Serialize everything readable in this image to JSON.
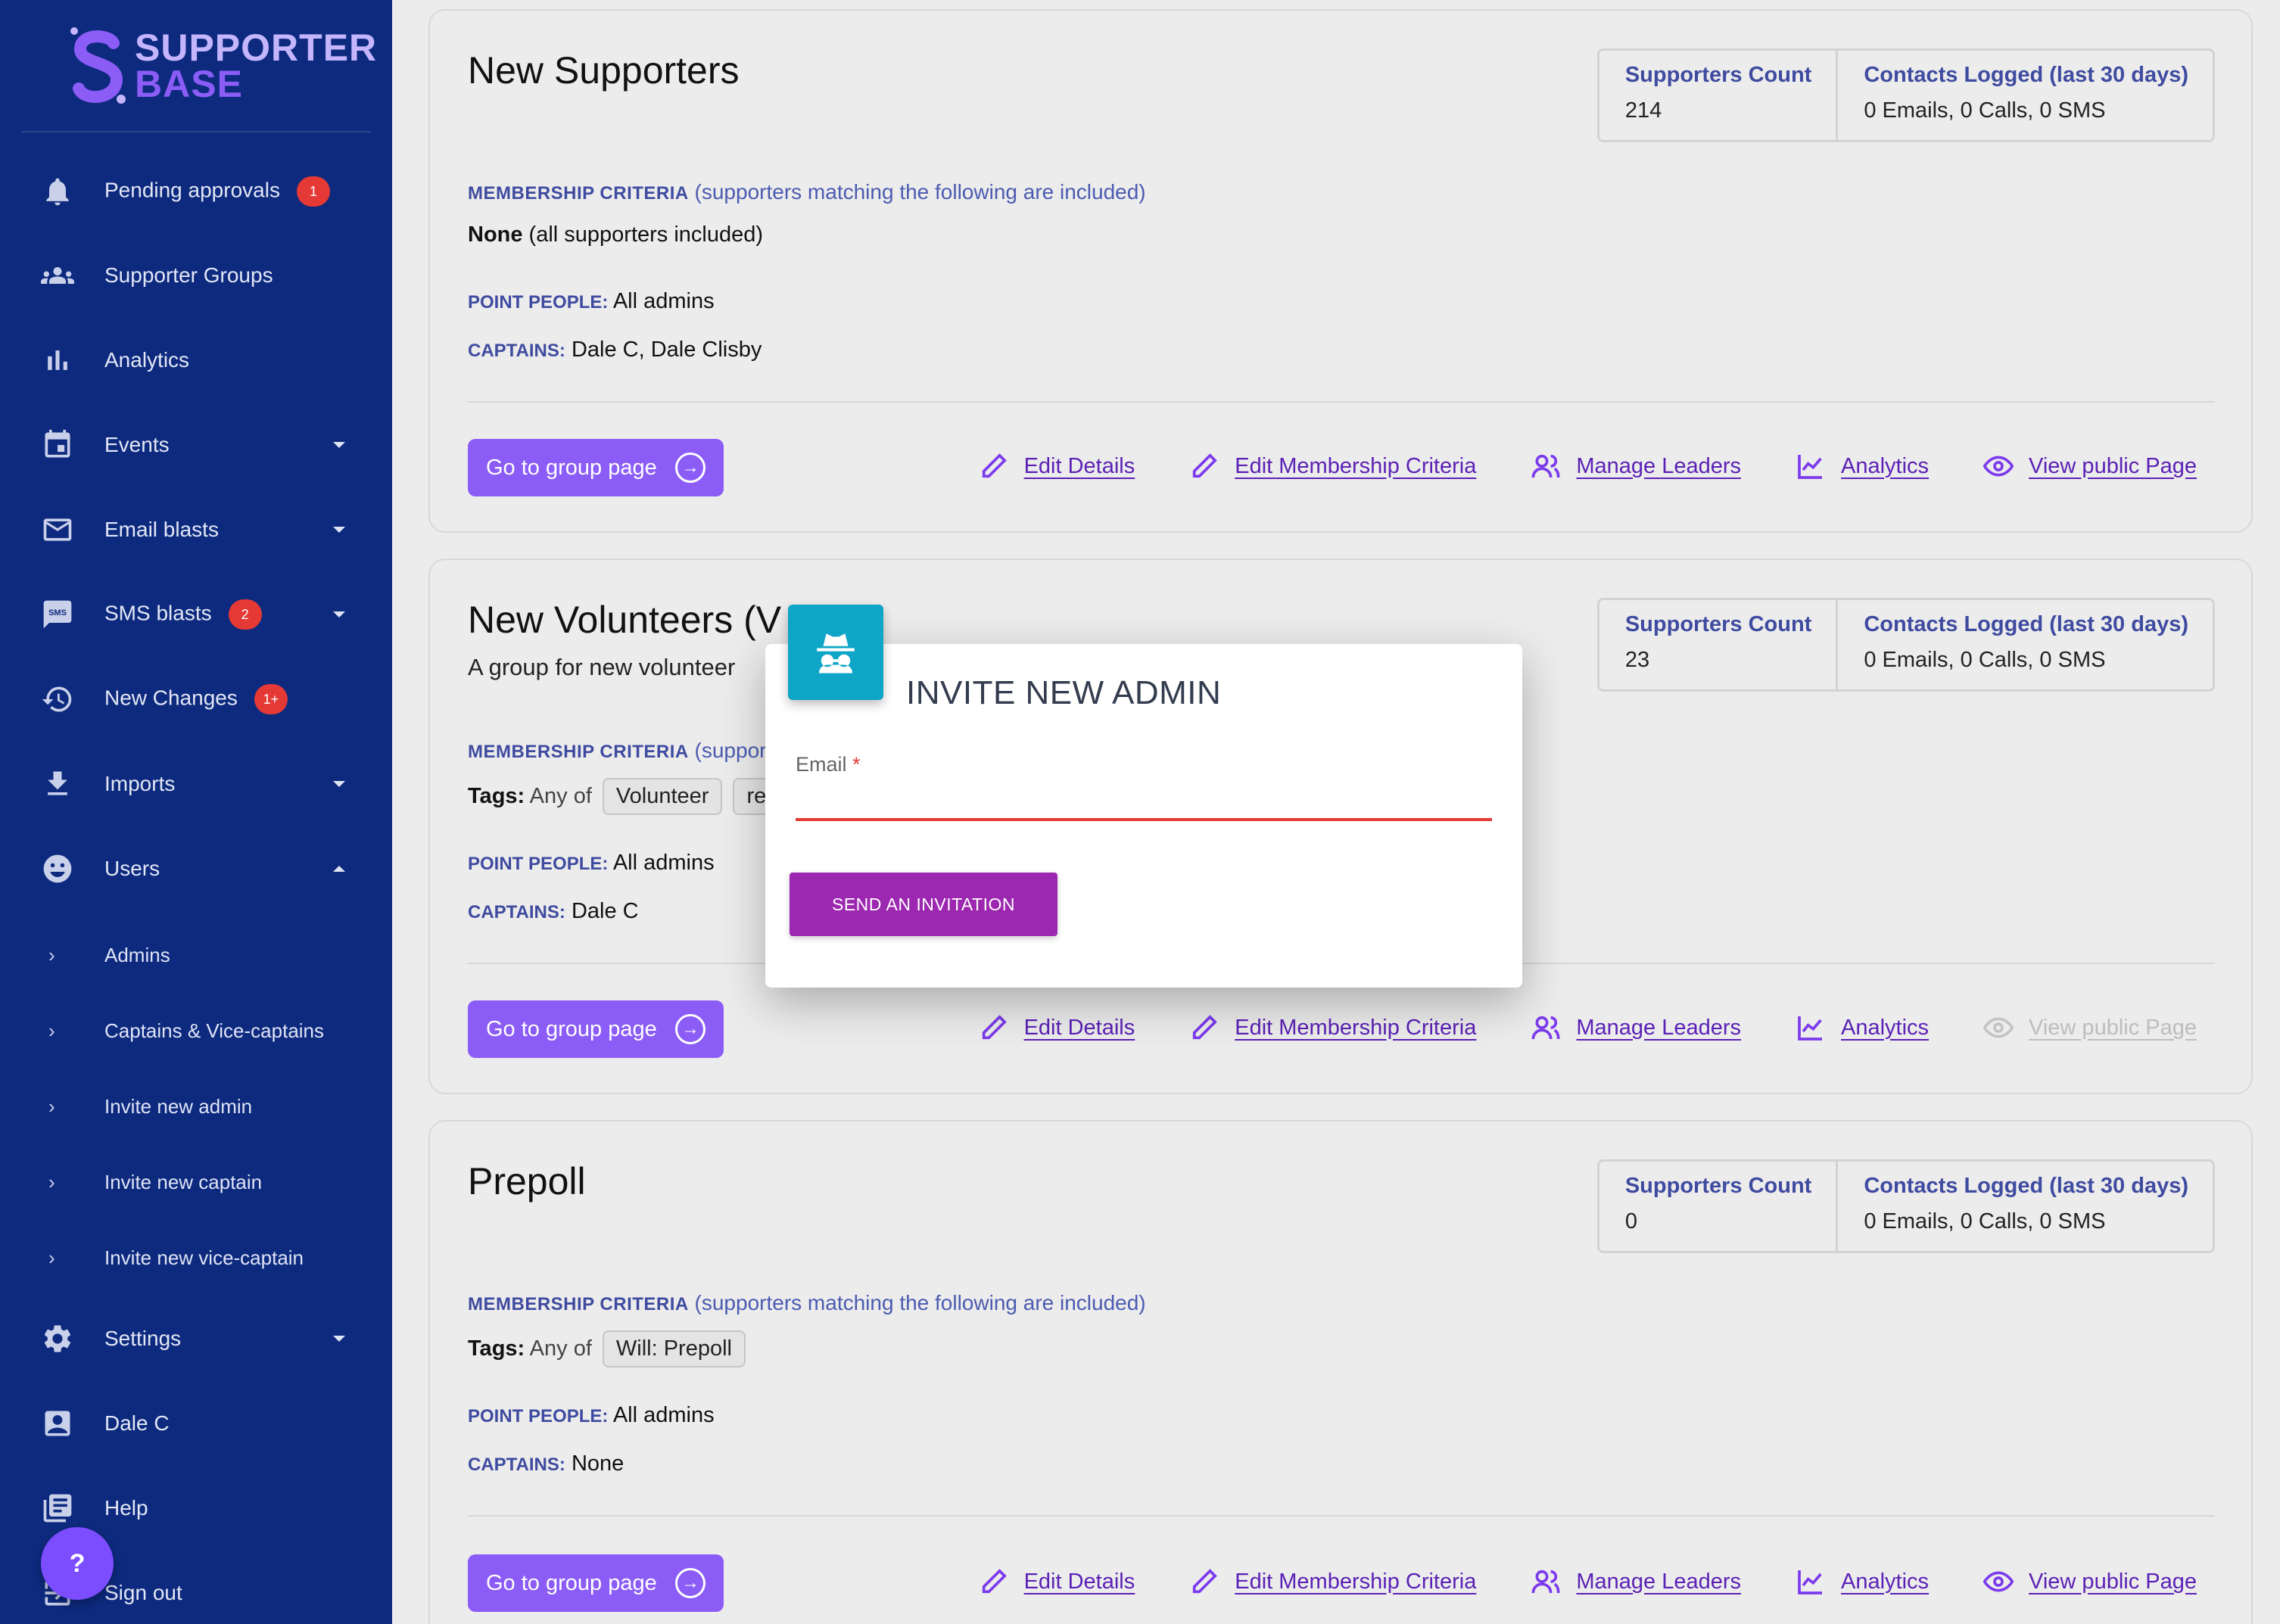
{
  "brand": {
    "line1": "SUPPORTER",
    "line2": "BASE"
  },
  "sidebar": {
    "items": [
      {
        "label": "Pending approvals",
        "badge": "1",
        "icon": "bell-icon"
      },
      {
        "label": "Supporter Groups",
        "icon": "groups-icon"
      },
      {
        "label": "Analytics",
        "icon": "bar-chart-icon"
      },
      {
        "label": "Events",
        "icon": "calendar-icon"
      },
      {
        "label": "Email blasts",
        "icon": "mail-icon"
      },
      {
        "label": "SMS blasts",
        "badge": "2",
        "icon": "sms-icon"
      },
      {
        "label": "New Changes",
        "badge": "1+",
        "icon": "history-icon"
      },
      {
        "label": "Imports",
        "icon": "download-icon"
      },
      {
        "label": "Users",
        "icon": "users-icon"
      },
      {
        "label": "Settings",
        "icon": "gear-icon"
      },
      {
        "label": "Dale C",
        "icon": "contact-icon"
      },
      {
        "label": "Help",
        "icon": "book-icon"
      },
      {
        "label": "Sign out",
        "icon": "sign-out-icon"
      }
    ],
    "users_sub": [
      "Admins",
      "Captains & Vice-captains",
      "Invite new admin",
      "Invite new captain",
      "Invite new vice-captain"
    ],
    "help_fab": "?"
  },
  "stats_labels": {
    "count": "Supporters Count",
    "contacts": "Contacts Logged (last 30 days)"
  },
  "labels": {
    "membership": "MEMBERSHIP CRITERIA",
    "membership_note": " (supporters matching the following are included)",
    "membership_note_cut": " (support",
    "point_people": "POINT PEOPLE:",
    "captains": "CAPTAINS:",
    "tags": "Tags:",
    "any_of": "Any of"
  },
  "actions": {
    "go": "Go to group page",
    "edit_details": "Edit Details",
    "edit_criteria": "Edit Membership Criteria",
    "manage_leaders": "Manage Leaders",
    "analytics": "Analytics",
    "view_public": "View public Page"
  },
  "groups": [
    {
      "title": "New Supporters",
      "count": "214",
      "contacts": "0 Emails, 0 Calls, 0 SMS",
      "criteria_none": "None",
      "criteria_none_note": " (all supporters included)",
      "point_people": "All admins",
      "captains": "Dale C, Dale Clisby"
    },
    {
      "title": "New Volunteers (V",
      "subtitle": "A group for new volunteer",
      "count": "23",
      "contacts": "0 Emails, 0 Calls, 0 SMS",
      "tags": [
        "Volunteer",
        "re"
      ],
      "point_people": "All admins",
      "captains": "Dale C"
    },
    {
      "title": "Prepoll",
      "count": "0",
      "contacts": "0 Emails, 0 Calls, 0 SMS",
      "tags": [
        "Will: Prepoll"
      ],
      "point_people": "All admins",
      "captains": "None"
    }
  ],
  "modal": {
    "title": "INVITE NEW ADMIN",
    "email_label": "Email",
    "required_mark": "*",
    "email_value": "",
    "submit": "SEND AN INVITATION",
    "icon": "spy-icon"
  }
}
